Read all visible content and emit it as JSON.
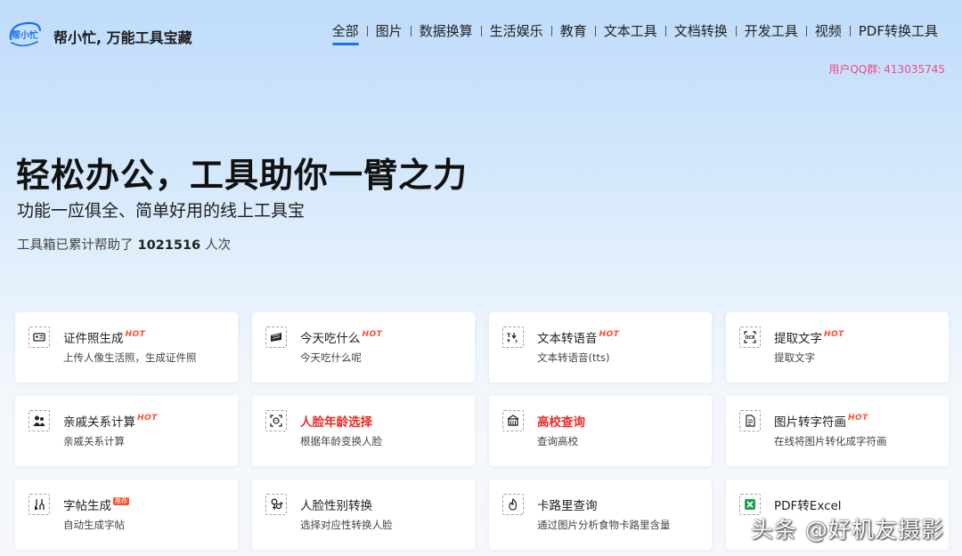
{
  "header": {
    "logo_text": "帮小忙",
    "brand": "帮小忙, 万能工具宝藏",
    "nav": [
      "全部",
      "图片",
      "数据换算",
      "生活娱乐",
      "教育",
      "文本工具",
      "文档转换",
      "开发工具",
      "视频",
      "PDF转换工具"
    ],
    "active_nav": "全部",
    "qq_label": "用户QQ群:",
    "qq_number": "413035745"
  },
  "hero": {
    "title": "轻松办公，工具助你一臂之力",
    "subtitle": "功能一应俱全、简单好用的线上工具宝",
    "stats_prefix": "工具箱已累计帮助了",
    "stats_count": "1021516",
    "stats_suffix": "人次"
  },
  "cards": [
    {
      "title": "证件照生成",
      "desc": "上传人像生活照，生成证件照",
      "badge": "HOT",
      "icon": "id-card-icon",
      "highlight": false
    },
    {
      "title": "今天吃什么",
      "desc": "今天吃什么呢",
      "badge": "HOT",
      "icon": "food-icon",
      "highlight": false
    },
    {
      "title": "文本转语音",
      "desc": "文本转语音(tts)",
      "badge": "HOT",
      "icon": "text-to-speech-icon",
      "highlight": false
    },
    {
      "title": "提取文字",
      "desc": "提取文字",
      "badge": "HOT",
      "icon": "ocr-icon",
      "highlight": false
    },
    {
      "title": "亲戚关系计算",
      "desc": "亲戚关系计算",
      "badge": "HOT",
      "icon": "people-icon",
      "highlight": false
    },
    {
      "title": "人脸年龄选择",
      "desc": "根据年龄变换人脸",
      "badge": "",
      "icon": "face-icon",
      "highlight": true
    },
    {
      "title": "高校查询",
      "desc": "查询高校",
      "badge": "",
      "icon": "school-icon",
      "highlight": true
    },
    {
      "title": "图片转字符画",
      "desc": "在线将图片转化成字符画",
      "badge": "HOT",
      "icon": "image-to-text-icon",
      "highlight": false
    },
    {
      "title": "字帖生成",
      "desc": "自动生成字帖",
      "badge": "推荐",
      "icon": "brush-icon",
      "highlight": false
    },
    {
      "title": "人脸性别转换",
      "desc": "选择对应性转换人脸",
      "badge": "",
      "icon": "gender-icon",
      "highlight": false
    },
    {
      "title": "卡路里查询",
      "desc": "通过图片分析食物卡路里含量",
      "badge": "",
      "icon": "calorie-icon",
      "highlight": false
    },
    {
      "title": "PDF转Excel",
      "desc": "",
      "badge": "",
      "icon": "excel-icon",
      "highlight": false
    }
  ],
  "watermark": "头条 @好机友摄影",
  "colors": {
    "accent": "#1a73e8",
    "hot": "#ff4d2e",
    "highlight_title": "#e62b25",
    "qq": "#ea4c89"
  }
}
